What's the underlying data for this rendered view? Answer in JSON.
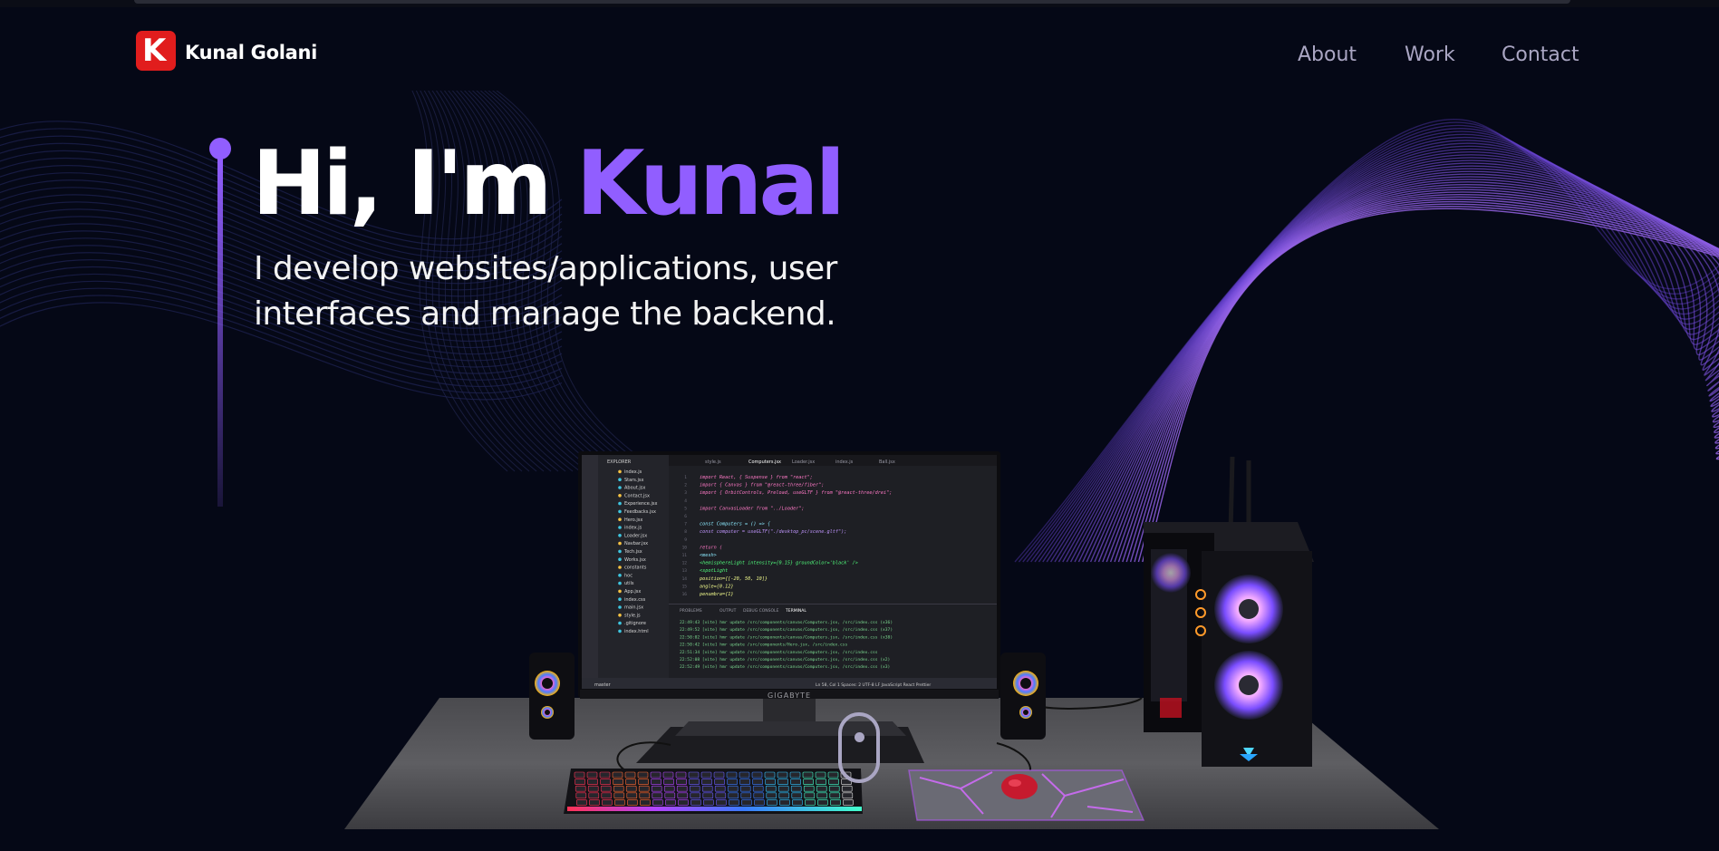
{
  "brand": {
    "logo_letter": "K",
    "name": "Kunal Golani"
  },
  "nav": {
    "links": [
      "About",
      "Work",
      "Contact"
    ]
  },
  "hero": {
    "greeting": "Hi, I'm ",
    "name": "Kunal",
    "subtitle": "I develop websites/applications, user interfaces and manage the backend."
  },
  "monitor": {
    "brand_label": "GIGABYTE",
    "editor_tabs": [
      "style.js",
      "Computers.jsx",
      "Loader.jsx",
      "index.js",
      "Ball.jsx"
    ],
    "explorer_title": "EXPLORER",
    "files": [
      "index.js",
      "Stars.jsx",
      "About.jsx",
      "Contact.jsx",
      "Experience.jsx",
      "Feedbacks.jsx",
      "Hero.jsx",
      "index.js",
      "Loader.jsx",
      "Navbar.jsx",
      "Tech.jsx",
      "Works.jsx",
      "constants",
      "hoc",
      "utils",
      "App.jsx",
      "index.css",
      "main.jsx",
      "style.js",
      ".gitignore",
      "index.html"
    ],
    "code_lines": [
      "import React, { Suspense } from \"react\";",
      "import { Canvas } from \"@react-three/fiber\";",
      "import { OrbitControls, Preload, useGLTF } from \"@react-three/drei\";",
      "",
      "import CanvasLoader from \"../Loader\";",
      "",
      "const Computers = () => {",
      "  const computer = useGLTF(\"./desktop_pc/scene.gltf\");",
      "",
      "  return (",
      "    <mesh>",
      "      <hemisphereLight intensity={0.15} groundColor='black' />",
      "      <spotLight",
      "        position={[-20, 50, 10]}",
      "        angle={0.12}",
      "        penumbra={1}"
    ],
    "panel_tabs": [
      "PROBLEMS",
      "OUTPUT",
      "DEBUG CONSOLE",
      "TERMINAL"
    ],
    "terminal_lines": [
      "22:49:43 [vite] hmr update /src/components/canvas/Computers.jsx, /src/index.css (x36)",
      "22:49:52 [vite] hmr update /src/components/canvas/Computers.jsx, /src/index.css (x37)",
      "22:50:02 [vite] hmr update /src/components/canvas/Computers.jsx, /src/index.css (x38)",
      "22:50:42 [vite] hmr update /src/components/Hero.jsx, /src/index.css",
      "22:51:34 [vite] hmr update /src/components/canvas/Computers.jsx, /src/index.css",
      "22:52:08 [vite] hmr update /src/components/canvas/Computers.jsx, /src/index.css (x2)",
      "22:52:49 [vite] hmr update /src/components/canvas/Computers.jsx, /src/index.css (x3)"
    ],
    "status_left": "master",
    "status_right": "Ln 58, Col 1   Spaces: 2   UTF-8   LF   JavaScript React   Prettier"
  },
  "colors": {
    "background": "#050816",
    "accent": "#915eff",
    "nav_link": "#aaa6c3",
    "logo": "#e11d1d",
    "text": "#ffffff"
  },
  "icons": [
    "logo-k-icon",
    "scroll-mouse-icon"
  ]
}
